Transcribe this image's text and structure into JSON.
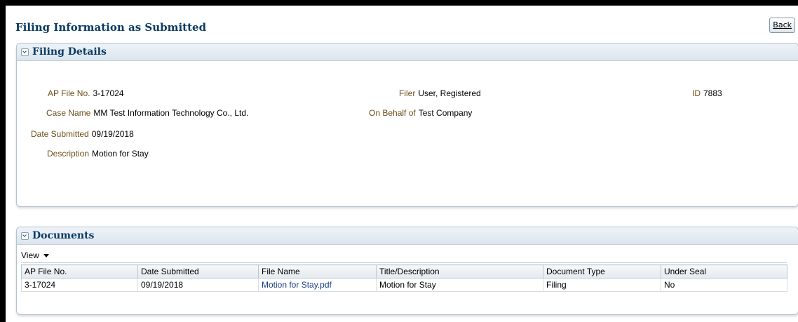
{
  "header": {
    "title": "Filing Information as Submitted",
    "back_label": "Back"
  },
  "filing_details": {
    "title": "Filing Details",
    "ap_file_no": {
      "label": "AP File No.",
      "value": "3-17024"
    },
    "case_name": {
      "label": "Case Name",
      "value": "MM Test Information Technology Co., Ltd."
    },
    "date_submitted": {
      "label": "Date Submitted",
      "value": "09/19/2018"
    },
    "description": {
      "label": "Description",
      "value": "Motion for Stay"
    },
    "filer": {
      "label": "Filer",
      "value": "User, Registered"
    },
    "on_behalf_of": {
      "label": "On Behalf of",
      "value": "Test Company"
    },
    "id": {
      "label": "ID",
      "value": "7883"
    }
  },
  "documents": {
    "title": "Documents",
    "view_label": "View",
    "columns": [
      "AP File No.",
      "Date Submitted",
      "File Name",
      "Title/Description",
      "Document Type",
      "Under Seal"
    ],
    "rows": [
      [
        "3-17024",
        "09/19/2018",
        "Motion for Stay.pdf",
        "Motion for Stay",
        "Filing",
        "No"
      ]
    ]
  },
  "colors": {
    "title": "#0b3b63",
    "label": "#6b4e1a",
    "link": "#1a3f8a"
  },
  "icons": [
    "collapse-icon",
    "dropdown-caret-icon"
  ]
}
